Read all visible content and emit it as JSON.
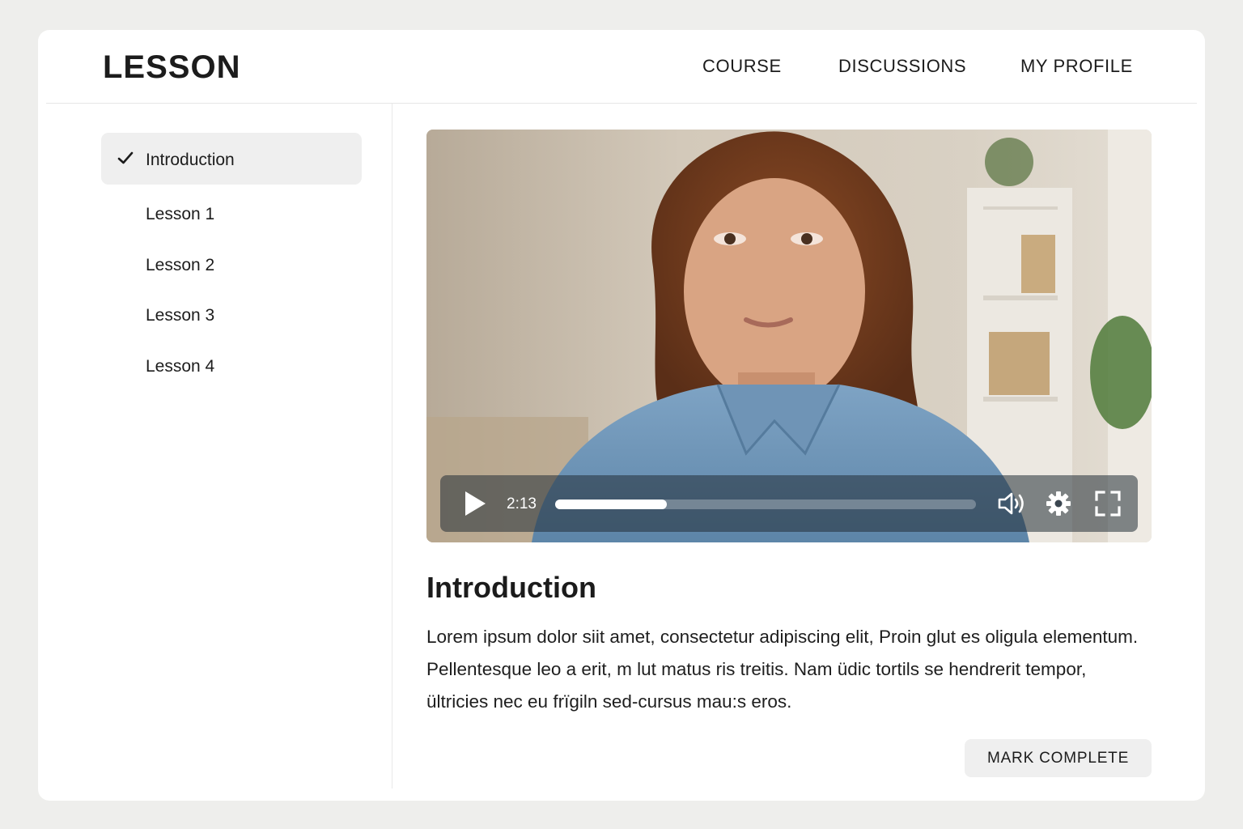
{
  "header": {
    "brand": "LESSON",
    "nav": [
      "COURSE",
      "DISCUSSIONS",
      "MY PROFILE"
    ]
  },
  "sidebar": {
    "items": [
      {
        "label": "Introduction",
        "active": true,
        "completed": true
      },
      {
        "label": "Lesson 1",
        "active": false,
        "completed": false
      },
      {
        "label": "Lesson 2",
        "active": false,
        "completed": false
      },
      {
        "label": "Lesson 3",
        "active": false,
        "completed": false
      },
      {
        "label": "Lesson 4",
        "active": false,
        "completed": false
      }
    ]
  },
  "video": {
    "current_time": "2:13",
    "progress_fraction": 0.265,
    "icons": [
      "play-icon",
      "volume-icon",
      "settings-gear-icon",
      "fullscreen-icon"
    ]
  },
  "main": {
    "title": "Introduction",
    "body": "Lorem ipsum dolor siit amet, consectetur adipiscing elit, Proin glut es oligula elementum. Pellentesque leo a erit, m lut matus ris treitis. Nam üdic tortils se hendrerit tempor, ültricies nec eu frïgiln sed-cursus mau:s eros.",
    "mark_complete_label": "MARK COMPLETE"
  },
  "colors": {
    "background": "#eeeeec",
    "card": "#ffffff",
    "active_item": "#efefef",
    "text": "#1b1b1b"
  }
}
